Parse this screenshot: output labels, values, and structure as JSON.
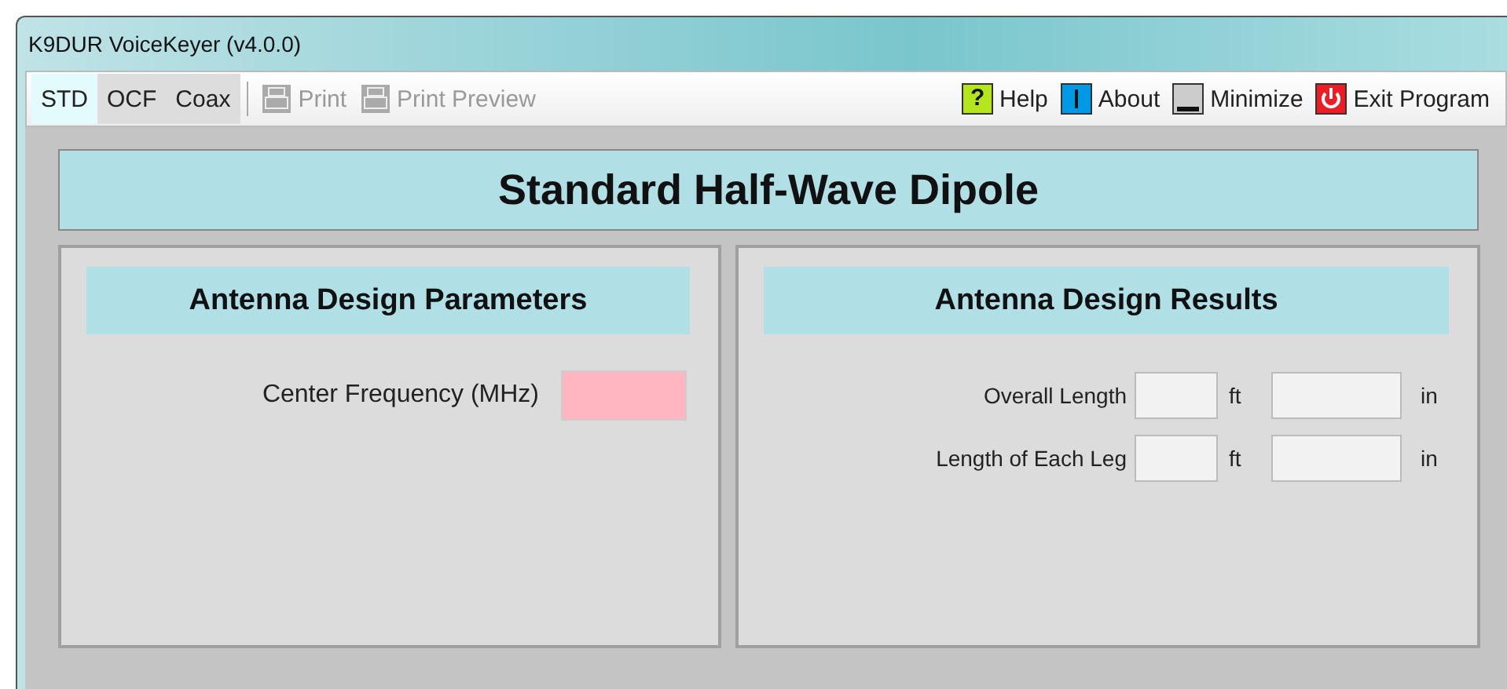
{
  "window": {
    "title": "K9DUR VoiceKeyer (v4.0.0)"
  },
  "tabs": [
    {
      "label": "STD",
      "selected": true
    },
    {
      "label": "OCF",
      "selected": false
    },
    {
      "label": "Coax",
      "selected": false
    }
  ],
  "print_actions": [
    {
      "label": "Print",
      "disabled": true
    },
    {
      "label": "Print Preview",
      "disabled": true
    }
  ],
  "app_actions": [
    {
      "kind": "help",
      "label": "Help",
      "icon": "?"
    },
    {
      "kind": "about",
      "label": "About"
    },
    {
      "kind": "minimize",
      "label": "Minimize"
    },
    {
      "kind": "exit",
      "label": "Exit Program"
    }
  ],
  "banner": "Standard Half-Wave Dipole",
  "parameters": {
    "title": "Antenna Design Parameters",
    "fields": [
      {
        "label": "Center Frequency (MHz)",
        "invalid": true
      }
    ]
  },
  "results": {
    "title": "Antenna Design Results",
    "rows": [
      {
        "label": "Overall Length",
        "unit_1": "ft",
        "unit_2": "in"
      },
      {
        "label": "Length of Each Leg",
        "unit_1": "ft",
        "unit_2": "in"
      }
    ]
  }
}
